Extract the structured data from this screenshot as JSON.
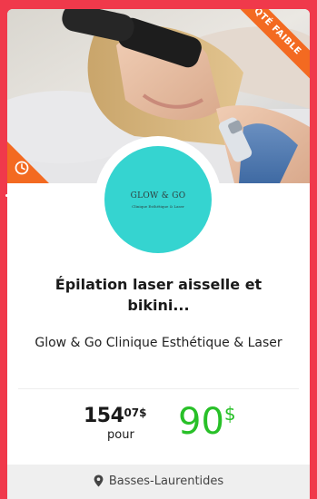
{
  "deal": {
    "badge": "QTÉ FAIBLE",
    "logo": {
      "name": "GLOW & GO",
      "tagline": "Clinique Esthétique & Laser"
    },
    "title": "Épilation laser aisselle et bikini...",
    "merchant": "Glow & Go Clinique Esthétique & Laser",
    "price_old": {
      "integer": "154",
      "cents": "07",
      "currency": "$",
      "unit": "pour"
    },
    "price_new": {
      "integer": "90",
      "currency": "$"
    },
    "location": "Basses-Laurentides"
  },
  "colors": {
    "page_background": "#f0394b",
    "badge": "#f36a21",
    "logo_circle": "#35d4d0",
    "new_price": "#28c028",
    "footer": "#efefef"
  },
  "icons": {
    "corner": "clock-icon",
    "location": "map-pin-icon"
  }
}
